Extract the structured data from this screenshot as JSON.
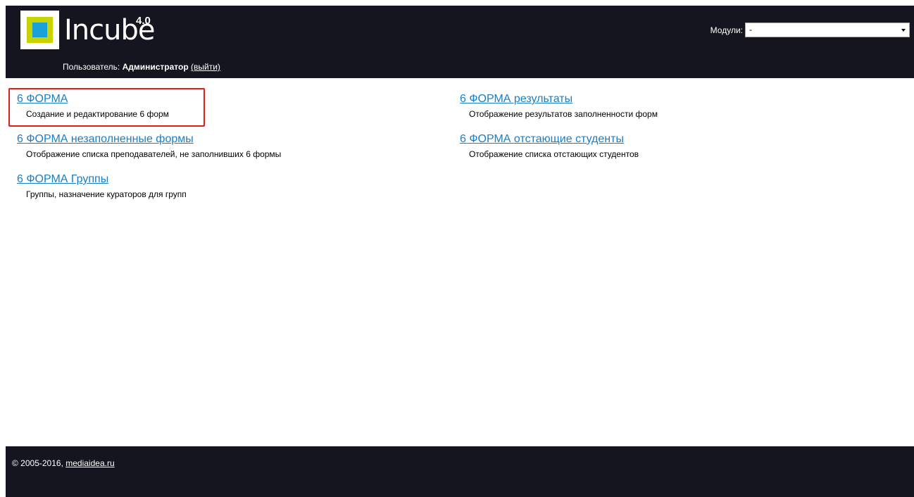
{
  "header": {
    "brand": "Incube",
    "version": "4.0",
    "user_label": "Пользователь:",
    "user_name": "Администратор",
    "logout_label": "(выйти)",
    "modules_label": "Модули:",
    "modules_selected": "-"
  },
  "modules": [
    {
      "title": "6 ФОРМА",
      "description": "Создание и редактирование 6 форм"
    },
    {
      "title": "6 ФОРМА незаполненные формы",
      "description": "Отображение списка преподавателей, не заполнивших 6 формы"
    },
    {
      "title": "6 ФОРМА Группы",
      "description": "Группы, назначение кураторов для групп"
    },
    {
      "title": "6 ФОРМА результаты",
      "description": "Отображение результатов заполненности форм"
    },
    {
      "title": "6 ФОРМА отстающие студенты",
      "description": "Отображение списка отстающих студентов"
    }
  ],
  "footer": {
    "copyright": "© 2005-2016,",
    "site_link": "mediaidea.ru"
  },
  "colors": {
    "header_bg": "#15151f",
    "link": "#1a7ec8",
    "highlight": "#e21b1b",
    "logo_outer": "#c8d400",
    "logo_inner": "#1aa0d8"
  }
}
